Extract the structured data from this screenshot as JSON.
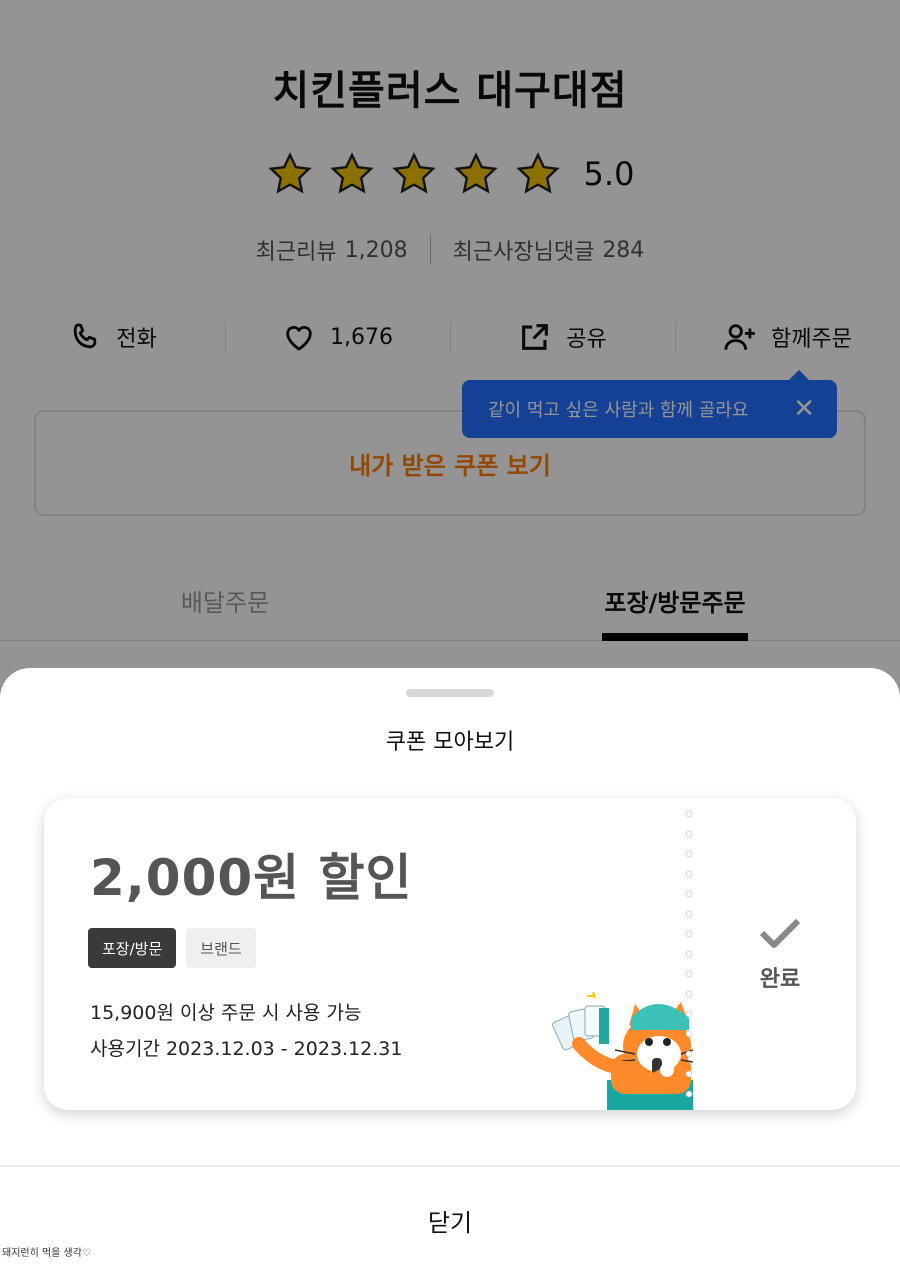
{
  "store": {
    "name": "치킨플러스 대구대점",
    "rating": "5.0",
    "stars_filled": 5,
    "recent_reviews_label": "최근리뷰",
    "recent_reviews_count": "1,208",
    "owner_replies_label": "최근사장님댓글",
    "owner_replies_count": "284",
    "actions": {
      "call": "전화",
      "likes": "1,676",
      "share": "공유",
      "group_order": "함께주문"
    },
    "tooltip": "같이 먹고 싶은 사람과 함께 골라요",
    "my_coupons_button": "내가 받은 쿠폰 보기",
    "tabs": [
      "배달주문",
      "포장/방문주문"
    ]
  },
  "sheet": {
    "title": "쿠폰 모아보기",
    "coupon": {
      "amount": "2,000원 할인",
      "tags": [
        "포장/방문",
        "브랜드"
      ],
      "condition": "15,900원 이상 주문 시 사용 가능",
      "period": "사용기간 2023.12.03 - 2023.12.31",
      "status": "완료"
    },
    "close": "닫기"
  },
  "watermark": "돼지런히 먹을 생각♡",
  "colors": {
    "accent_orange": "#ff7f00",
    "tooltip_blue": "#2470ff",
    "star_gold": "#f2c300"
  }
}
